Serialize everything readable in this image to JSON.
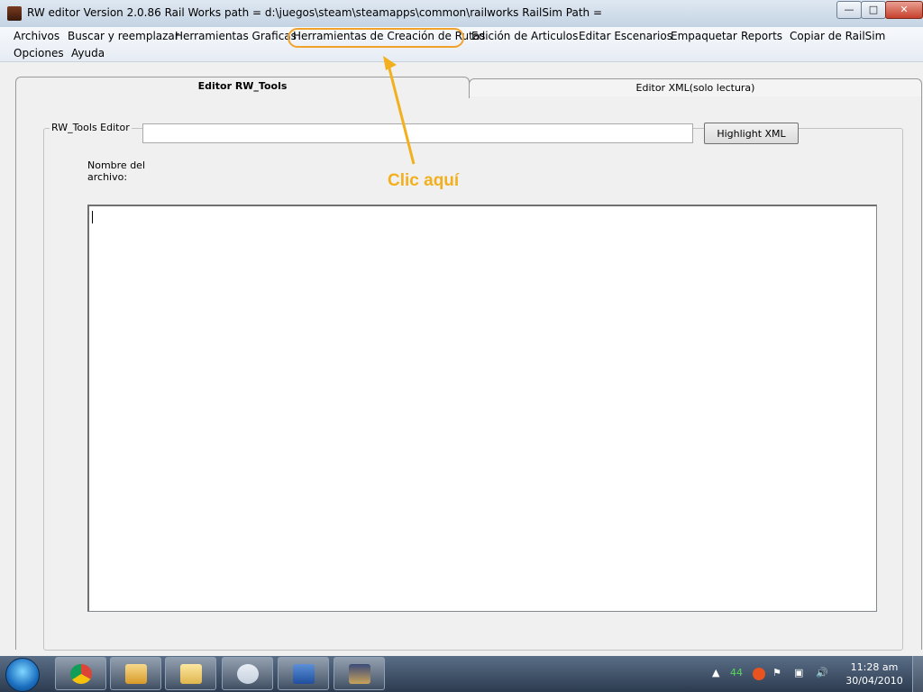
{
  "window": {
    "title": "RW editor  Version 2.0.86   Rail Works path = d:\\juegos\\steam\\steamapps\\common\\railworks  RailSim Path =",
    "min_glyph": "—",
    "max_glyph": "□",
    "close_glyph": "✕"
  },
  "menu": {
    "items": [
      "Archivos",
      "Buscar y reemplazar",
      "Herramientas Graficas",
      "Herramientas de Creación de Rutas",
      "Edición de Articulos",
      "Editar Escenarios",
      "Empaquetar",
      "Reports",
      "Copiar de RailSim",
      "Opciones",
      "Ayuda"
    ]
  },
  "tabs": {
    "active": "Editor RW_Tools",
    "inactive": "Editor XML(solo lectura)"
  },
  "editor": {
    "group_label": "RW_Tools Editor",
    "filename_value": "",
    "file_label": "Nombre del archivo:",
    "highlight_button": "Highlight XML",
    "content": ""
  },
  "annotation": {
    "text": "Clic aquí",
    "color": "#f2b01e"
  },
  "taskbar": {
    "tray_volume_level": "44",
    "time": "11:28 am",
    "date": "30/04/2010",
    "pinned_icons": [
      "chrome-icon",
      "presentation-icon",
      "explorer-icon",
      "snipping-tool-icon",
      "word-icon",
      "train-app-icon"
    ]
  }
}
